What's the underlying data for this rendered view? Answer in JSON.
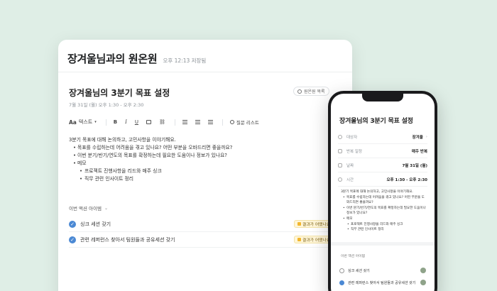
{
  "desktop": {
    "title": "장겨울님과의 원온원",
    "saved": "오후 12:13 저장됨",
    "doc_title": "장겨울님의 3분기 목표 설정",
    "doc_date": "7월 31일 (월) 오후 1:30 - 오후 2:30",
    "one_on_one_button": "원온원 목록",
    "toolbar": {
      "text_style": "텍스트",
      "checklist": "질문 리스트"
    },
    "body": {
      "intro": "3분기 목표에 대해 논의하고, 고민사항을 이야기해요.",
      "bullets": [
        "목표를 수립하는데 어려움을 겪고 있나요? 어떤 부분을 오바드리면 좋을까요?",
        "이번 분기/반기/연도의 목표를 확정하는데 필요한 도움이나 정보가 있나요?",
        "메모"
      ],
      "sub_bullets": [
        "프로젝트 진행사항을 리드와 매주 싱크",
        "직무 관련 인사이트 정리"
      ]
    },
    "actions_header": "이번 액션 아이템",
    "actions": [
      {
        "label": "싱크 세션 갖기",
        "badge": "결과가 어땠나요?"
      },
      {
        "label": "관련 레퍼런스 찾아서 팀원들과 공유세션 갖기",
        "badge": "결과가 어땠나요?"
      }
    ]
  },
  "phone": {
    "title": "장겨울님의 3분기 목표 설정",
    "rows": [
      {
        "label": "대상자",
        "value": "장겨울",
        "icon": "person-icon"
      },
      {
        "label": "반복 일정",
        "value": "매주 반복",
        "icon": "repeat-icon"
      },
      {
        "label": "날짜",
        "value": "7월 31일 (월)",
        "icon": "calendar-icon"
      },
      {
        "label": "시간",
        "value": "오후 1:30 - 오후 2:30",
        "icon": "clock-icon"
      }
    ],
    "body": {
      "intro": "3분기 목표에 대해 논의하고, 고민사항을 이야기해요.",
      "bullets": [
        "목표를 수립하는데 어려움을 겪고 있나요? 어떤 부분을 도와드리면 좋을까요?",
        "이번 분기/반기/연도의 목표를 확정하는데 필요한 도움이나 정보가 있나요?",
        "메모"
      ],
      "sub_bullets": [
        "프로젝트 진행사항을 리드와 매주 싱크",
        "직무 관련 인사이트 정리"
      ]
    },
    "actions_header": "이번 액션 아이템",
    "actions": [
      {
        "label": "싱크 세션 갖기",
        "done": false
      },
      {
        "label": "관련 레퍼런스 찾아서 팀원들과 공유세션 갖기",
        "done": true
      }
    ]
  },
  "colors": {
    "background": "#dfeee6",
    "accent": "#4b89d4",
    "badge_bg": "#fff6d8"
  }
}
